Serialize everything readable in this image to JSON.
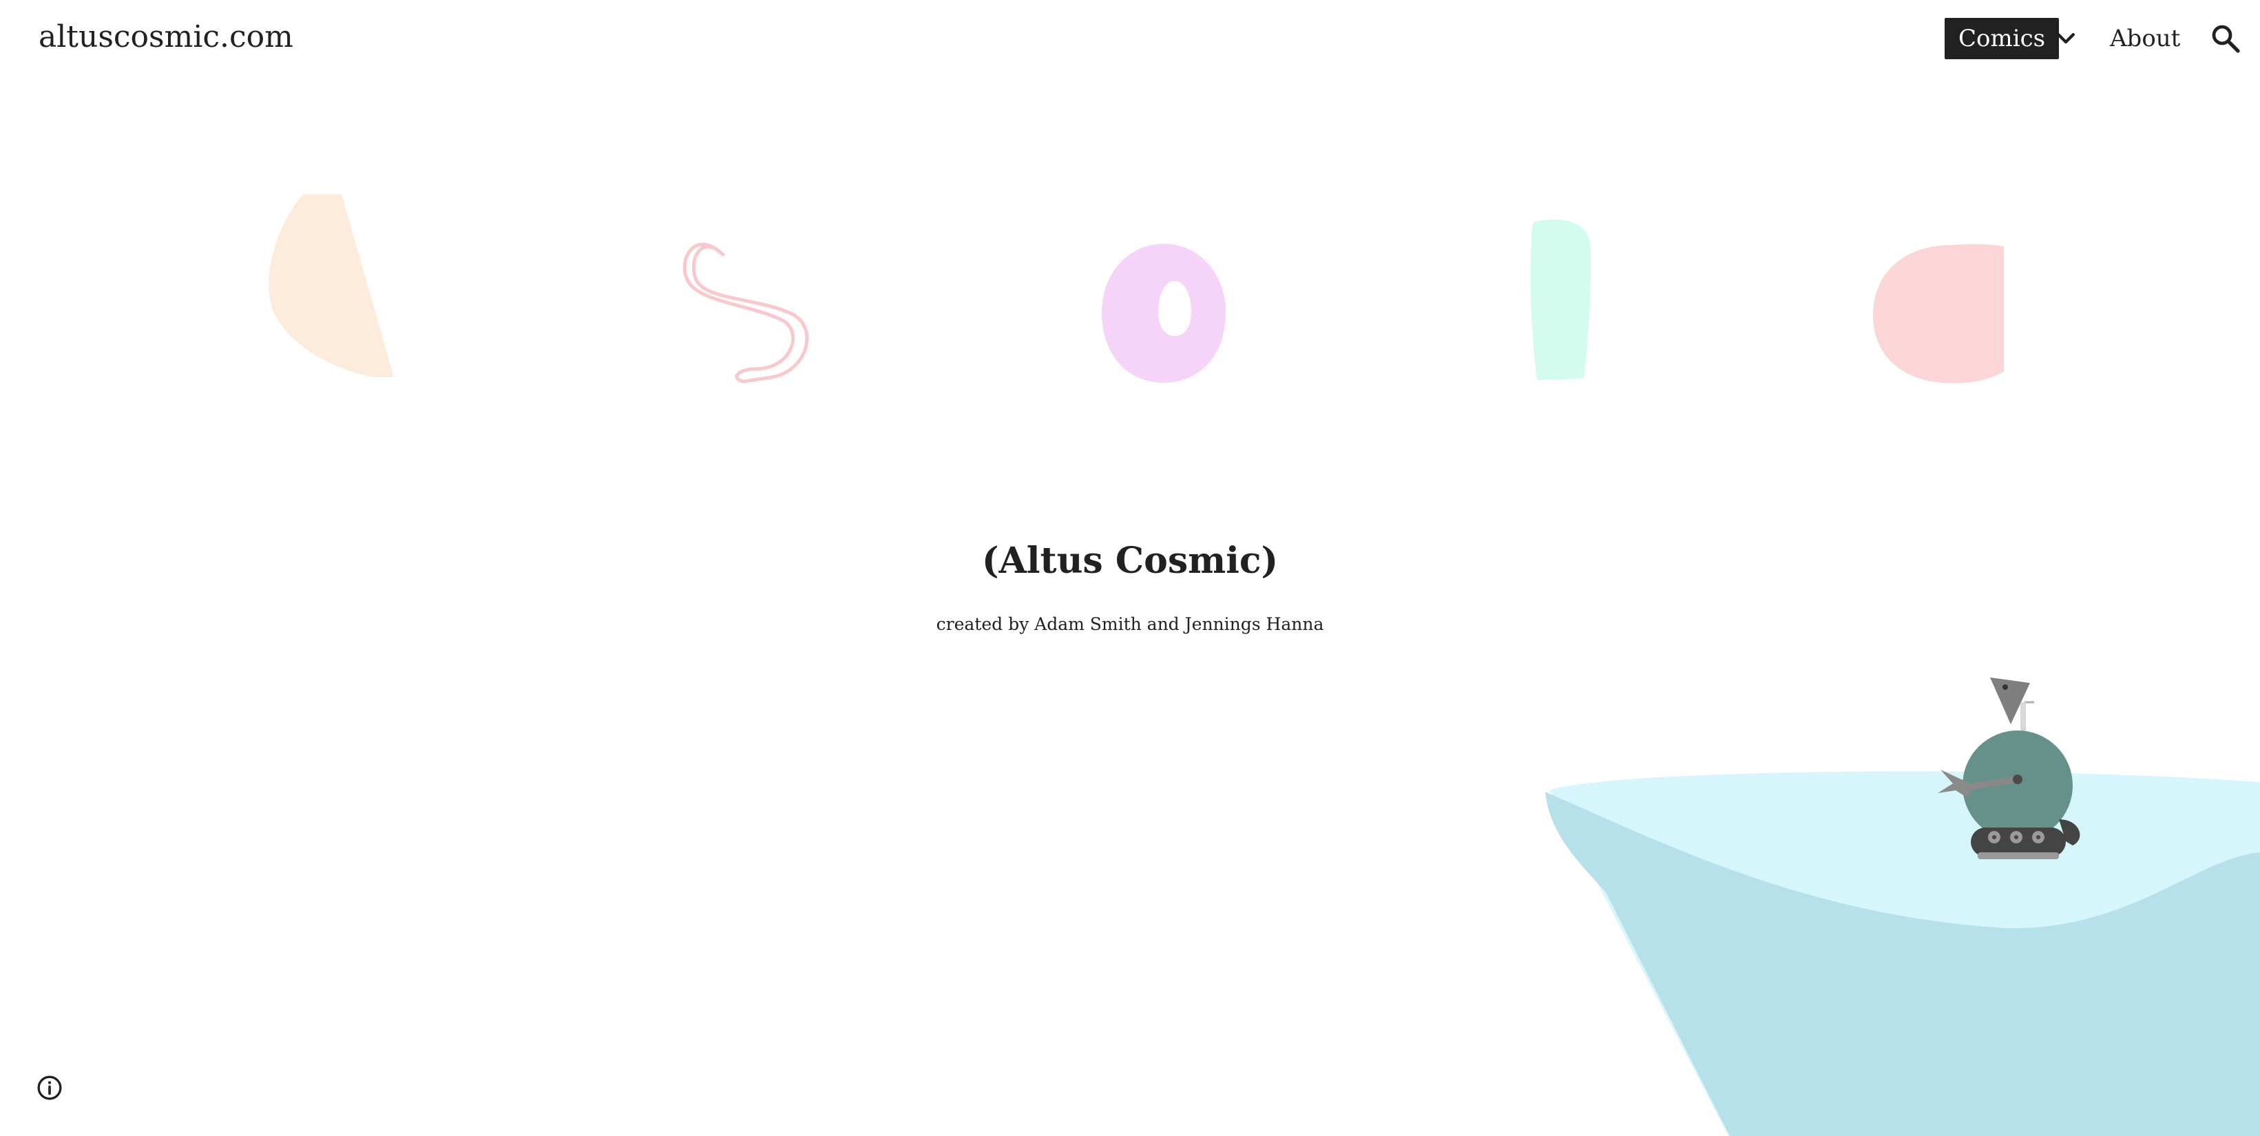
{
  "header": {
    "site_title": "altuscosmic.com",
    "nav": {
      "comics_label": "Comics",
      "about_label": "About"
    },
    "icons": {
      "dropdown": "chevron-down-icon",
      "search": "search-icon"
    }
  },
  "main": {
    "heading": "(Altus Cosmic)",
    "subtitle": "created by Adam Smith and Jennings Hanna"
  },
  "footer": {
    "info_icon": "info-icon"
  },
  "colors": {
    "nav_active_bg": "#212121",
    "nav_active_text": "#ffffff",
    "text": "#212121",
    "shape_peach": "#FDEBDB",
    "shape_pink_outline": "#F9C8CC",
    "shape_violet": "#F6D4FA",
    "shape_mint": "#D4FCEE",
    "shape_salmon": "#FCD6D7",
    "cliff_light": "#D6F6FC",
    "cliff_dark": "#B6E1EA",
    "robot_body": "#66918A"
  }
}
